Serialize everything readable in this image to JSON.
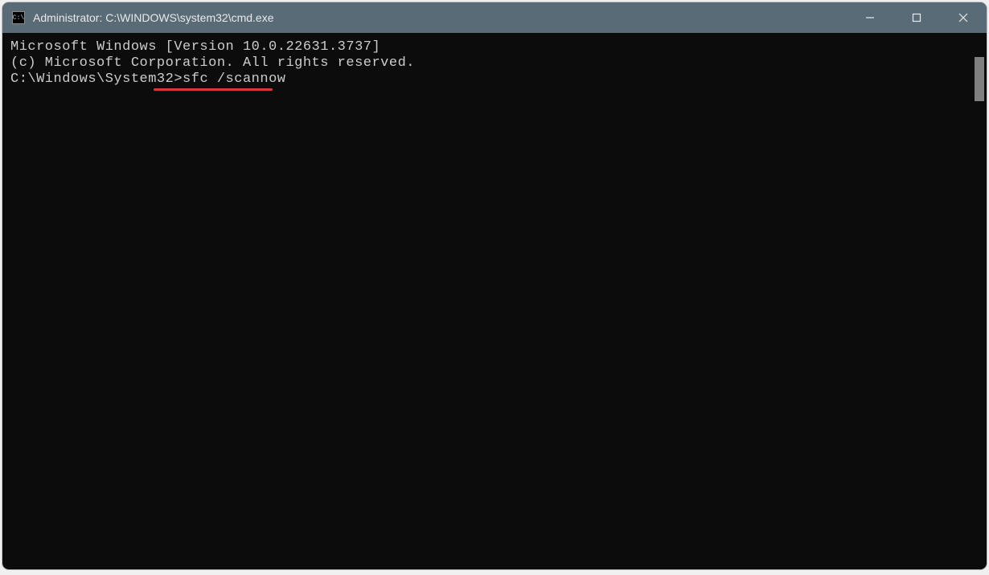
{
  "window": {
    "title": "Administrator: C:\\WINDOWS\\system32\\cmd.exe",
    "icon_label": "C:\\"
  },
  "terminal": {
    "line1": "Microsoft Windows [Version 10.0.22631.3737]",
    "line2": "(c) Microsoft Corporation. All rights reserved.",
    "blank": "",
    "prompt": "C:\\Windows\\System32>",
    "command": "sfc /scannow"
  },
  "annotation": {
    "underline_target": "sfc /scannow",
    "color": "#d93838"
  }
}
